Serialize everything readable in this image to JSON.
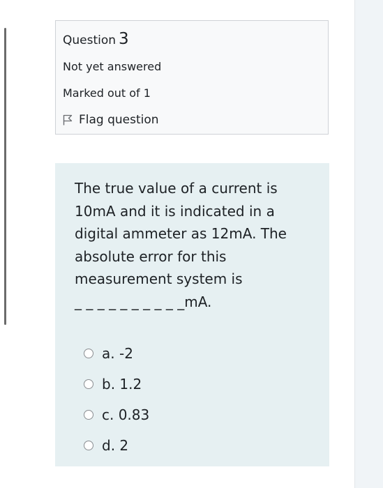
{
  "question_info": {
    "question_label": "Question",
    "question_number": "3",
    "status": "Not yet answered",
    "marks": "Marked out of 1",
    "flag_label": "Flag question"
  },
  "question": {
    "text": "The true value of a current is\n10mA and it is indicated in a\ndigital ammeter as 12mA. The\nabsolute error for this\nmeasurement system is\n_ _ _ _ _ _ _ _ _ _mA.",
    "options": [
      {
        "label": "a. -2"
      },
      {
        "label": "b. 1.2"
      },
      {
        "label": "c. 0.83"
      },
      {
        "label": "d. 2"
      }
    ]
  },
  "colors": {
    "info_bg": "#f8f9fa",
    "content_bg": "#e6f0f2",
    "text": "#1d2125"
  },
  "icons": {
    "flag": "flag-icon",
    "radio": "radio-icon"
  }
}
